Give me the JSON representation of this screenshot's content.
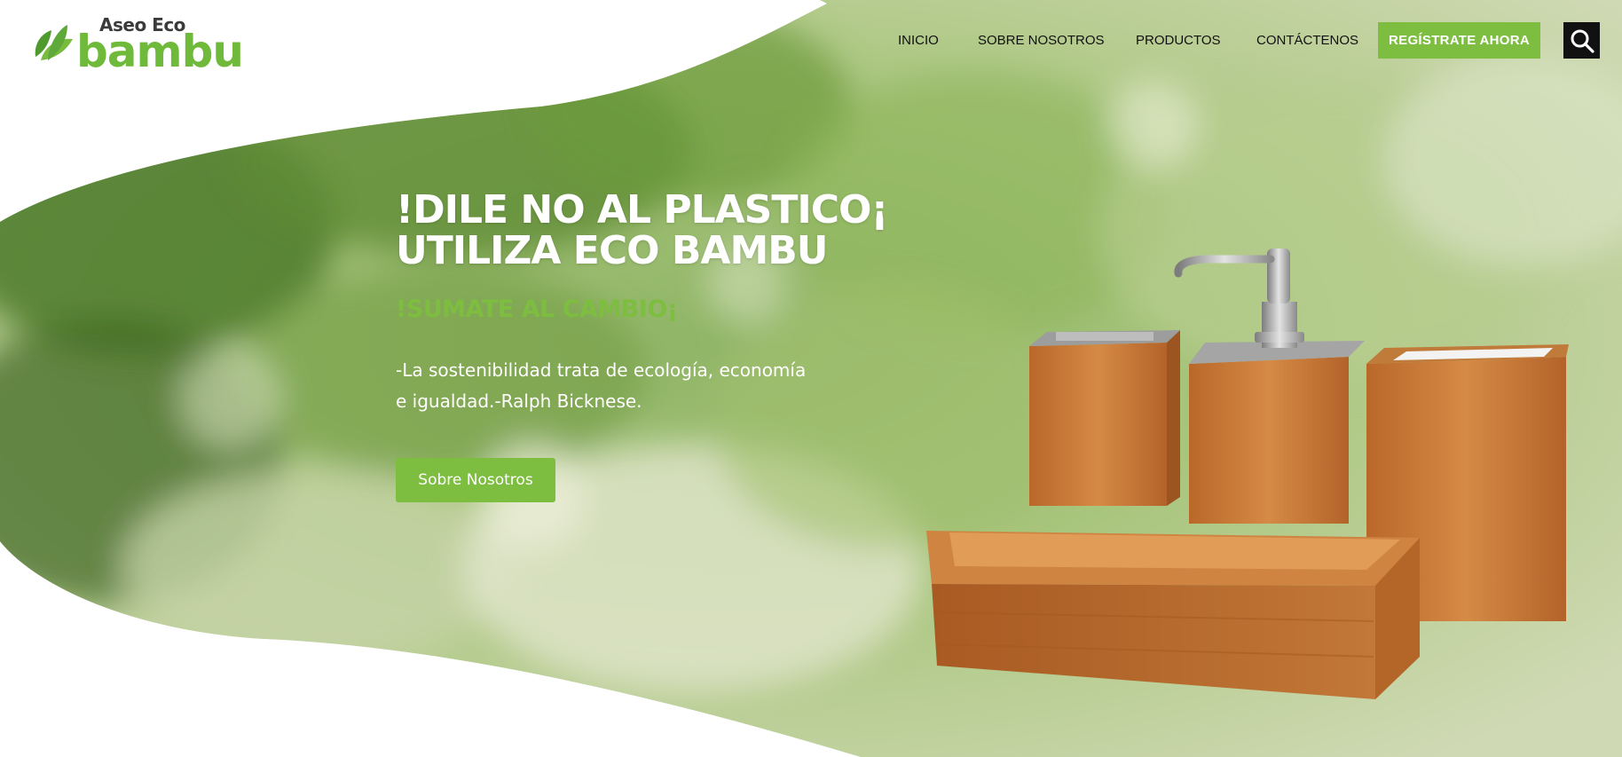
{
  "header": {
    "logo": {
      "small_text": "Aseo Eco",
      "big_text": "bambu"
    },
    "nav": [
      {
        "label": "INICIO"
      },
      {
        "label": "SOBRE NOSOTROS"
      },
      {
        "label": "PRODUCTOS"
      },
      {
        "label": "CONTÁCTENOS"
      }
    ],
    "cta_label": "REGÍSTRATE AHORA",
    "search_icon": "search-icon"
  },
  "hero": {
    "headline_line1": "!DILE NO AL PLASTICO¡",
    "headline_line2": "UTILIZA ECO BAMBU",
    "subhead": "!SUMATE AL CAMBIO¡",
    "quote_line1": "-La sostenibilidad trata de ecología, economía",
    "quote_line2": "e igualdad.-Ralph Bicknese.",
    "button_label": "Sobre Nosotros"
  },
  "colors": {
    "accent": "#7dbd3f",
    "dark": "#111111",
    "logo_green": "#6fb93b",
    "bamboo": "#c9772f"
  }
}
